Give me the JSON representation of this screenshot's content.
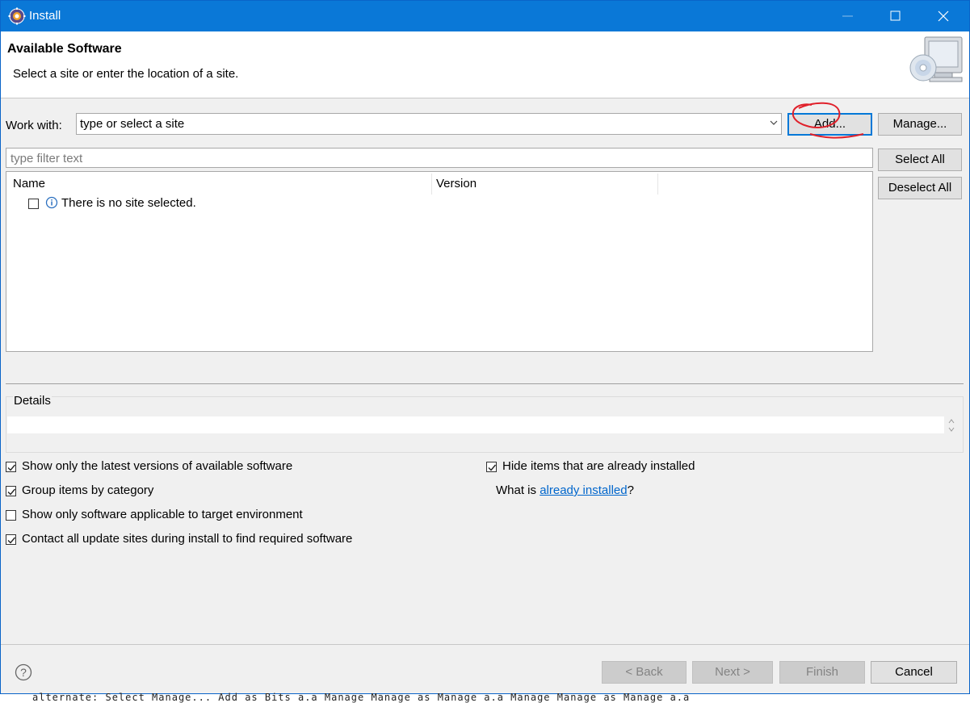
{
  "window": {
    "title": "Install"
  },
  "header": {
    "title": "Available Software",
    "message": "Select a site or enter the location of a site."
  },
  "work_with": {
    "label": "Work with:",
    "value": "type or select a site",
    "add_label": "Add...",
    "manage_label": "Manage..."
  },
  "filter": {
    "placeholder": "type filter text"
  },
  "buttons": {
    "select_all": "Select All",
    "deselect_all": "Deselect All"
  },
  "table": {
    "columns": [
      "Name",
      "Version"
    ],
    "rows": [
      {
        "name": "There is no site selected.",
        "checked": false
      }
    ]
  },
  "details": {
    "label": "Details"
  },
  "options": {
    "left": [
      {
        "label": "Show only the latest versions of available software",
        "checked": true
      },
      {
        "label": "Group items by category",
        "checked": true
      },
      {
        "label": "Show only software applicable to target environment",
        "checked": false
      },
      {
        "label": "Contact all update sites during install to find required software",
        "checked": true
      }
    ],
    "right": [
      {
        "label": "Hide items that are already installed",
        "checked": true
      }
    ],
    "what_is_prefix": "What is ",
    "what_is_link": "already installed",
    "what_is_suffix": "?"
  },
  "footer": {
    "back": "< Back",
    "next": "Next >",
    "finish": "Finish",
    "cancel": "Cancel"
  },
  "below_text": "alternate: Select Manage... Add as Bits a.a   Manage   Manage as Manage a.a   Manage  Manage as Manage a.a",
  "colors": {
    "titlebar": "#0a78d7",
    "annotation": "#e0202a",
    "link": "#0066cc"
  }
}
